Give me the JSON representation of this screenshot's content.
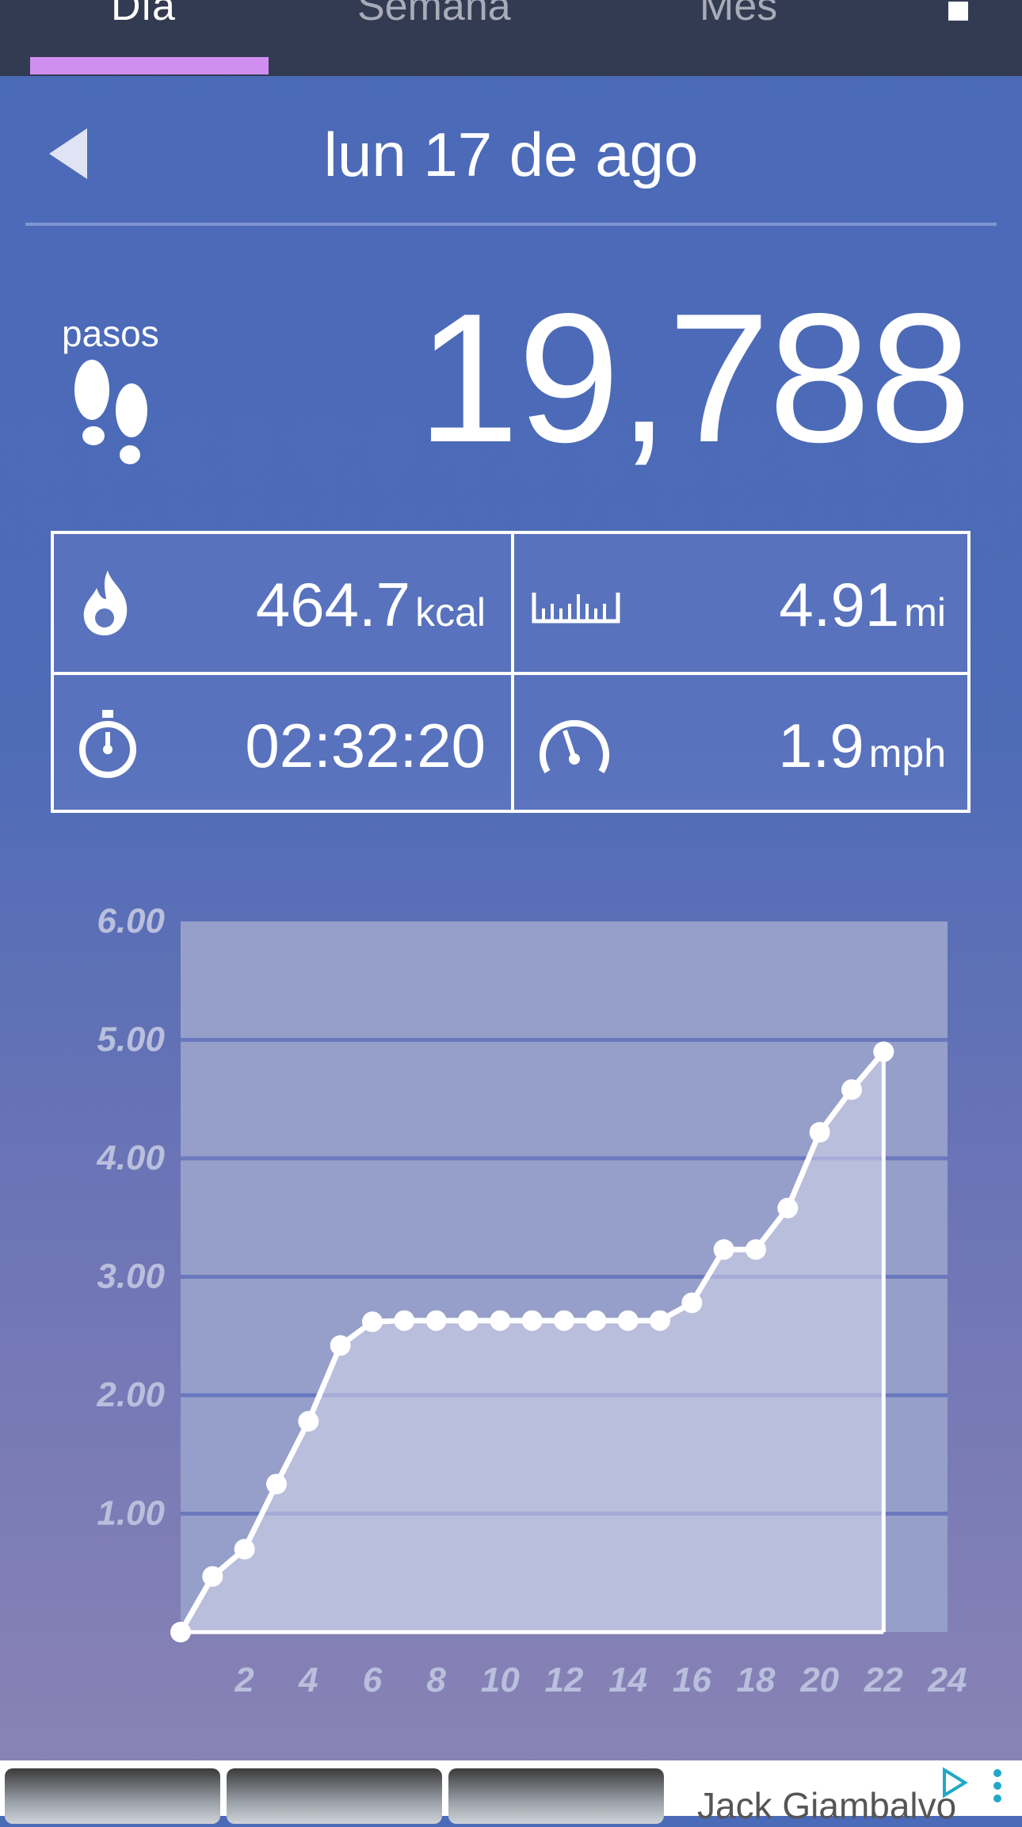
{
  "tabs": [
    {
      "label": "Día",
      "active": true
    },
    {
      "label": "Semana",
      "active": false
    },
    {
      "label": "Mes",
      "active": false
    }
  ],
  "header": {
    "date": "lun 17 de ago"
  },
  "steps": {
    "label": "pasos",
    "value": "19,788"
  },
  "stats": {
    "calories": {
      "value": "464.7",
      "unit": "kcal",
      "icon": "flame-icon"
    },
    "distance": {
      "value": "4.91",
      "unit": "mi",
      "icon": "ruler-icon"
    },
    "duration": {
      "value": "02:32:20",
      "icon": "stopwatch-icon"
    },
    "speed": {
      "value": "1.9",
      "unit": "mph",
      "icon": "speedometer-icon"
    }
  },
  "chart_data": {
    "type": "line",
    "x": [
      0,
      1,
      2,
      3,
      4,
      5,
      6,
      7,
      8,
      9,
      10,
      11,
      12,
      13,
      14,
      15,
      16,
      17,
      18,
      19,
      20,
      21,
      22
    ],
    "series": [
      {
        "values": [
          0,
          0.47,
          0.7,
          1.25,
          1.78,
          2.42,
          2.62,
          2.63,
          2.63,
          2.63,
          2.63,
          2.63,
          2.63,
          2.63,
          2.63,
          2.63,
          2.78,
          3.23,
          3.23,
          3.58,
          4.22,
          4.58,
          4.9
        ]
      }
    ],
    "xticks": [
      "2",
      "4",
      "6",
      "8",
      "10",
      "12",
      "14",
      "16",
      "18",
      "20",
      "22",
      "24"
    ],
    "yticks": [
      "1.00",
      "2.00",
      "3.00",
      "4.00",
      "5.00",
      "6.00"
    ],
    "xlim": [
      0,
      24
    ],
    "ylim": [
      0,
      6
    ],
    "grid": true,
    "colors": {
      "line": "#ffffff",
      "plot_bg": "#959fc9",
      "grid": "#6a78be",
      "tick_text": "#b9bfdc"
    }
  },
  "ad": {
    "text": "Jack Giambalvo",
    "icon": "ad-choices-icon"
  }
}
